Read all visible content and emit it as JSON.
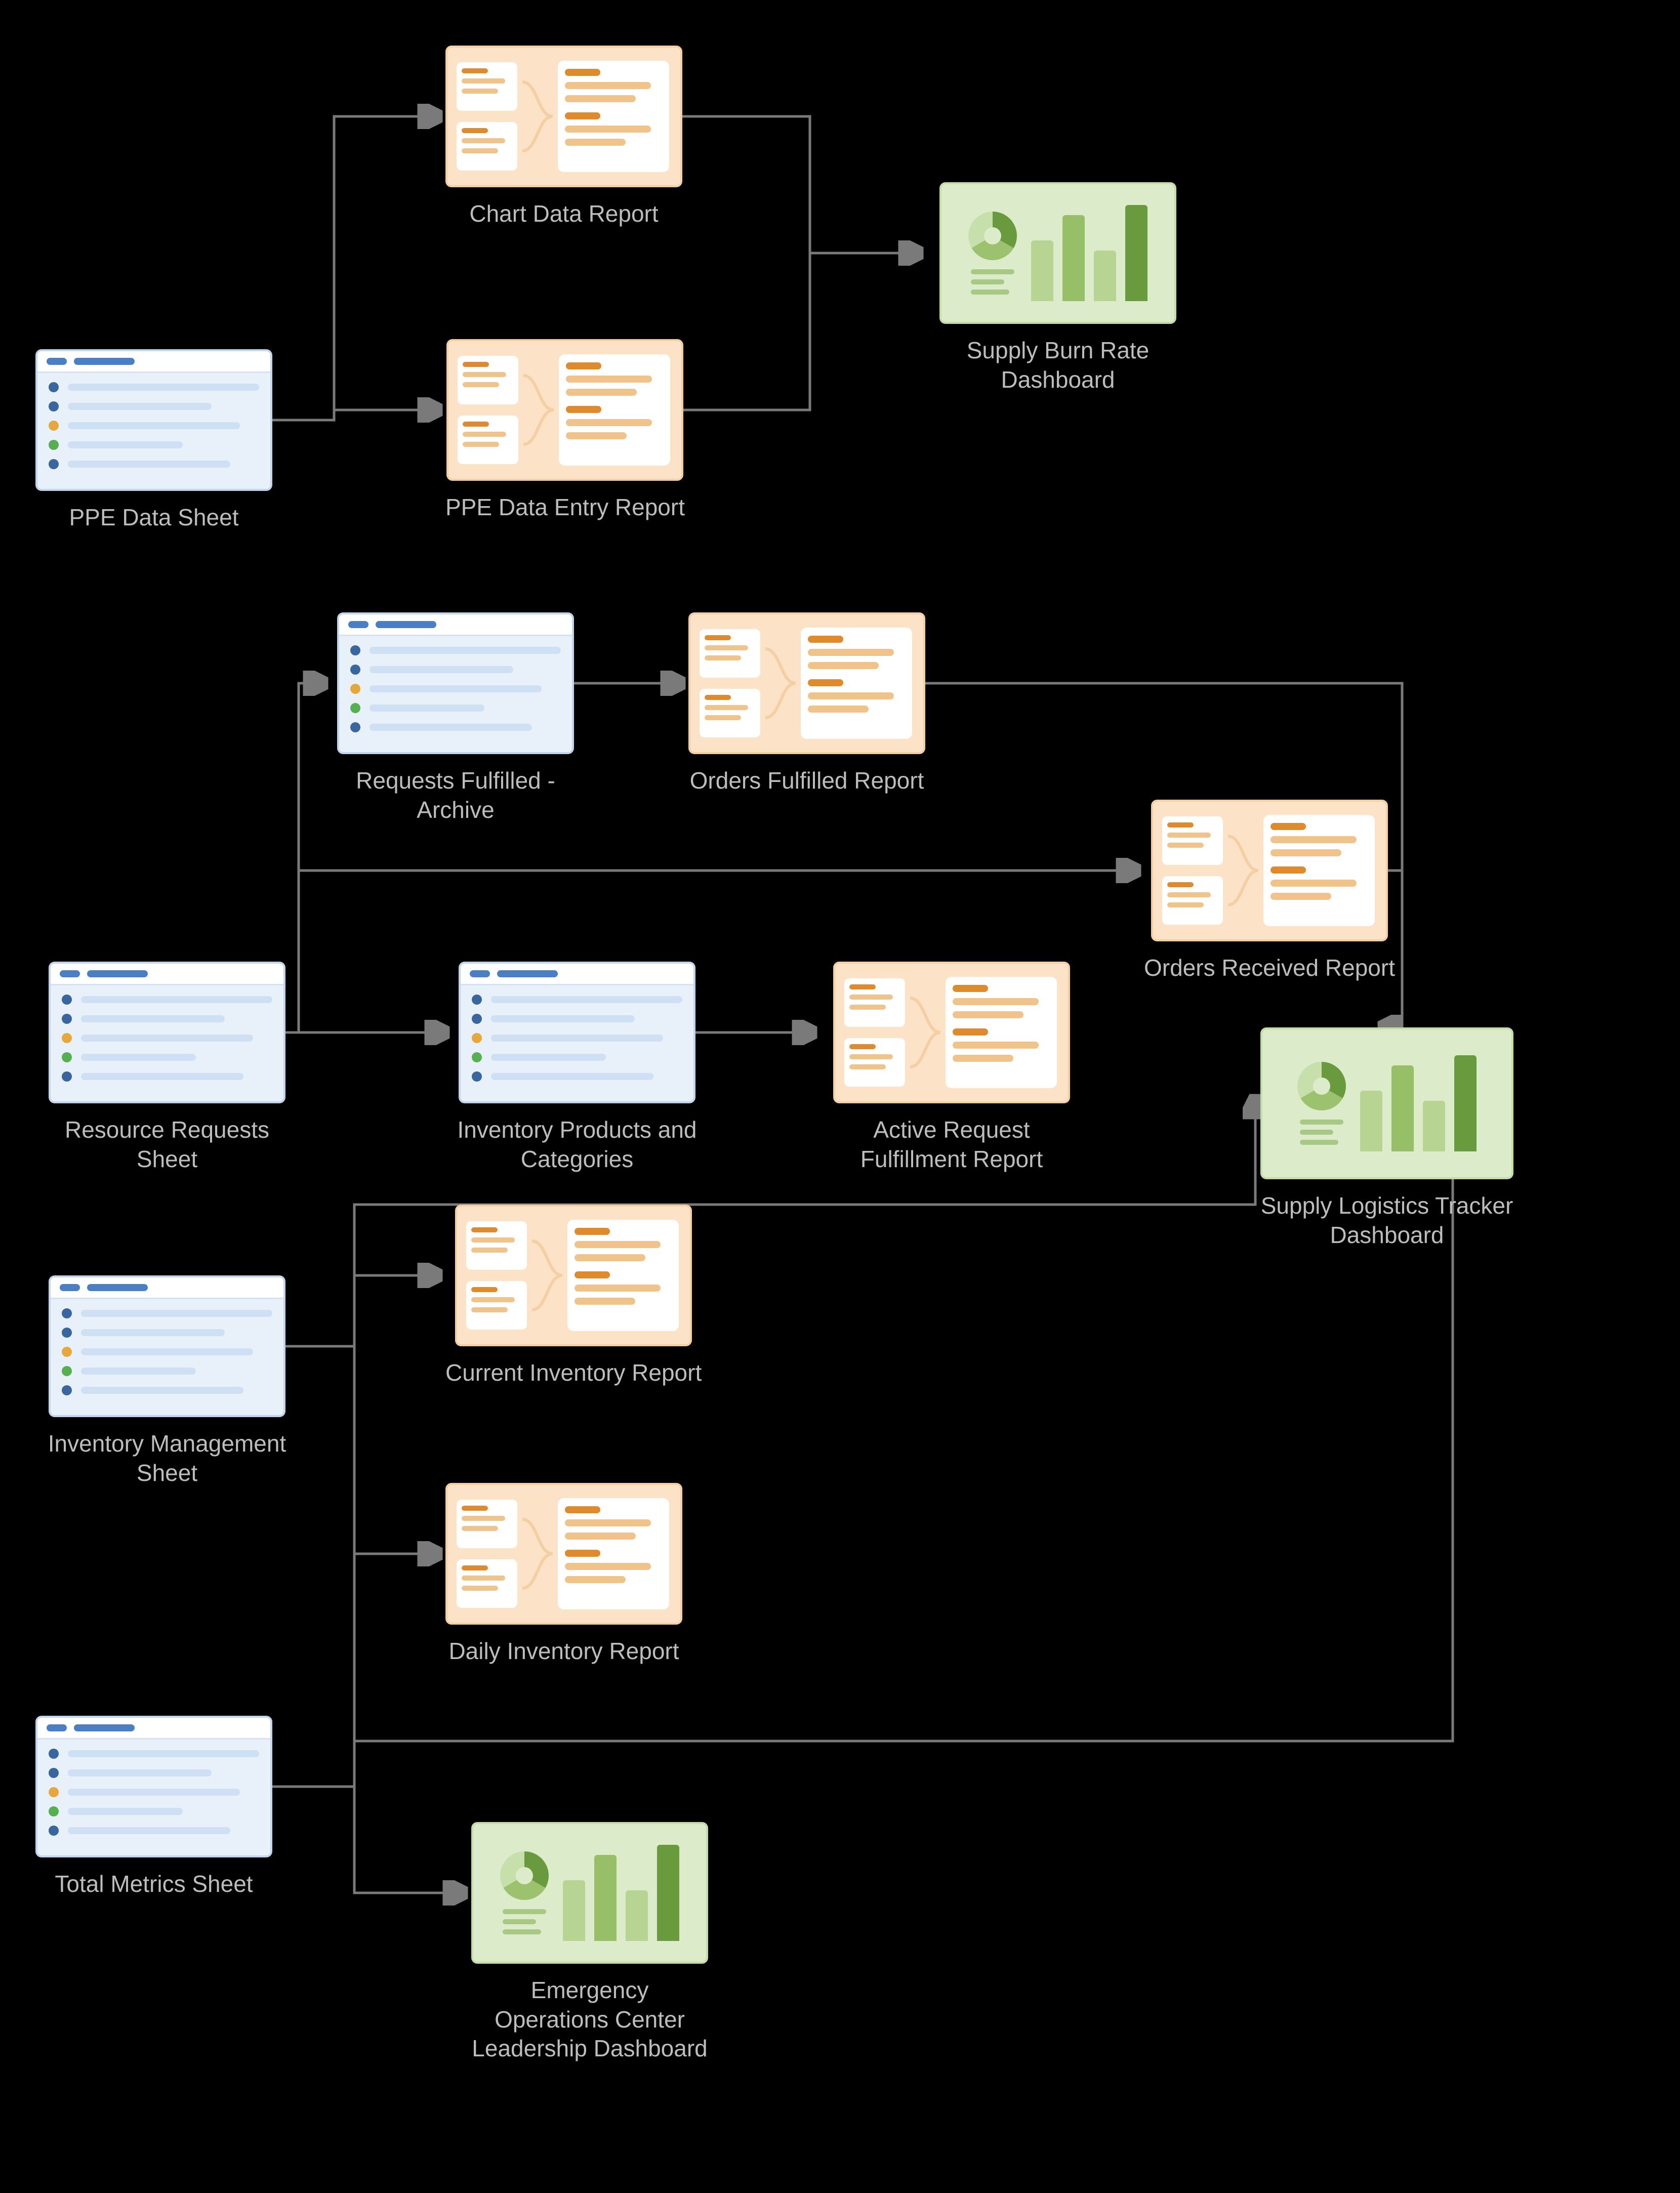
{
  "nodes": {
    "ppe_sheet": {
      "label": "PPE Data Sheet",
      "type": "sheet"
    },
    "chart_data": {
      "label": "Chart Data Report",
      "type": "report"
    },
    "ppe_entry": {
      "label": "PPE Data Entry Report",
      "type": "report"
    },
    "burn_dash": {
      "label": "Supply Burn Rate Dashboard",
      "type": "dashboard"
    },
    "req_archive": {
      "label": "Requests Fulfilled - Archive",
      "type": "sheet"
    },
    "orders_fulfilled": {
      "label": "Orders Fulfilled Report",
      "type": "report"
    },
    "orders_received": {
      "label": "Orders Received Report",
      "type": "report"
    },
    "resource_req": {
      "label": "Resource Requests Sheet",
      "type": "sheet"
    },
    "inv_products": {
      "label": "Inventory Products and Categories",
      "type": "sheet"
    },
    "active_fulfill": {
      "label": "Active Request Fulfillment Report",
      "type": "report"
    },
    "inv_mgmt": {
      "label": "Inventory Management Sheet",
      "type": "sheet"
    },
    "cur_inv": {
      "label": "Current Inventory Report",
      "type": "report"
    },
    "daily_inv": {
      "label": "Daily Inventory Report",
      "type": "report"
    },
    "total_metrics": {
      "label": "Total Metrics Sheet",
      "type": "sheet"
    },
    "eoc_dash": {
      "label": "Emergency Operations Center Leadership Dashboard",
      "type": "dashboard"
    },
    "logistics_dash": {
      "label": "Supply Logistics Tracker Dashboard",
      "type": "dashboard"
    }
  },
  "edges": [
    [
      "ppe_sheet",
      "chart_data"
    ],
    [
      "ppe_sheet",
      "ppe_entry"
    ],
    [
      "chart_data",
      "burn_dash"
    ],
    [
      "ppe_entry",
      "burn_dash"
    ],
    [
      "resource_req",
      "req_archive"
    ],
    [
      "req_archive",
      "orders_fulfilled"
    ],
    [
      "resource_req",
      "orders_received"
    ],
    [
      "resource_req",
      "inv_products"
    ],
    [
      "inv_products",
      "active_fulfill"
    ],
    [
      "inv_mgmt",
      "cur_inv"
    ],
    [
      "inv_mgmt",
      "daily_inv"
    ],
    [
      "total_metrics",
      "eoc_dash"
    ],
    [
      "inv_mgmt",
      "eoc_dash"
    ],
    [
      "orders_fulfilled",
      "logistics_dash"
    ],
    [
      "orders_received",
      "logistics_dash"
    ],
    [
      "total_metrics",
      "logistics_dash"
    ],
    [
      "inv_mgmt",
      "logistics_dash"
    ]
  ],
  "dot_palette": [
    "#3a66a0",
    "#3a66a0",
    "#e6a83a",
    "#56b04f",
    "#3a66a0"
  ]
}
